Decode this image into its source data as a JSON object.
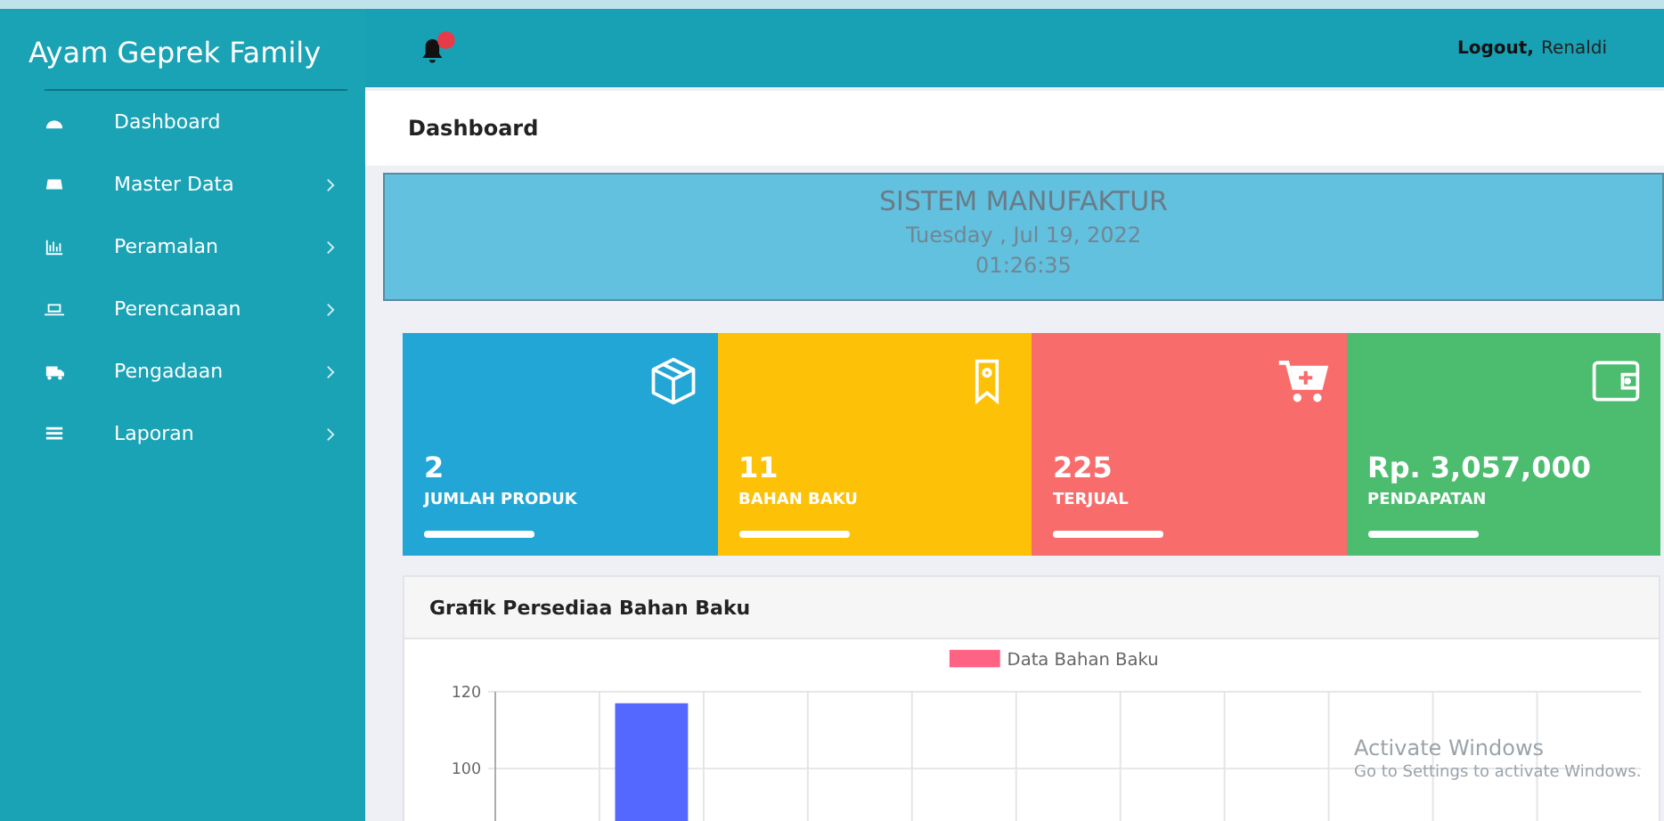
{
  "brand": "Ayam Geprek Family",
  "sidebar": {
    "items": [
      {
        "label": "Dashboard",
        "kind": "gauge",
        "has_submenu": false
      },
      {
        "label": "Master Data",
        "kind": "drive",
        "has_submenu": true
      },
      {
        "label": "Peramalan",
        "kind": "chart",
        "has_submenu": true
      },
      {
        "label": "Perencanaan",
        "kind": "laptop",
        "has_submenu": true
      },
      {
        "label": "Pengadaan",
        "kind": "truck",
        "has_submenu": true
      },
      {
        "label": "Laporan",
        "kind": "list",
        "has_submenu": true
      }
    ]
  },
  "topbar": {
    "notification_dot": true,
    "logout": "Logout,",
    "user": "Renaldi"
  },
  "page_title": "Dashboard",
  "banner": {
    "title": "SISTEM MANUFAKTUR",
    "date": "Tuesday , Jul 19, 2022",
    "time": "01:26:35"
  },
  "stats": [
    {
      "value": "2",
      "label": "JUMLAH PRODUK",
      "kind": "box",
      "color": "#22a6d6"
    },
    {
      "value": "11",
      "label": "BAHAN BAKU",
      "kind": "tag",
      "color": "#fdc107"
    },
    {
      "value": "225",
      "label": "TERJUAL",
      "kind": "cart",
      "color": "#f96c6c"
    },
    {
      "value": "Rp. 3,057,000",
      "label": "PENDAPATAN",
      "kind": "wallet",
      "color": "#4cbc6f"
    }
  ],
  "chart_panel": {
    "title": "Grafik Persediaa Bahan Baku",
    "chart_data": {
      "type": "bar",
      "series": [
        {
          "name": "Data Bahan Baku",
          "color": "#5468ff",
          "values": [
            null,
            117,
            null,
            null,
            null,
            null,
            null,
            null,
            null,
            null,
            null
          ]
        }
      ],
      "ylim": [
        0,
        120
      ],
      "yticks": [
        100,
        120
      ]
    }
  },
  "os_notice": {
    "title": "Activate Windows",
    "text": "Go to Settings to activate Windows."
  }
}
